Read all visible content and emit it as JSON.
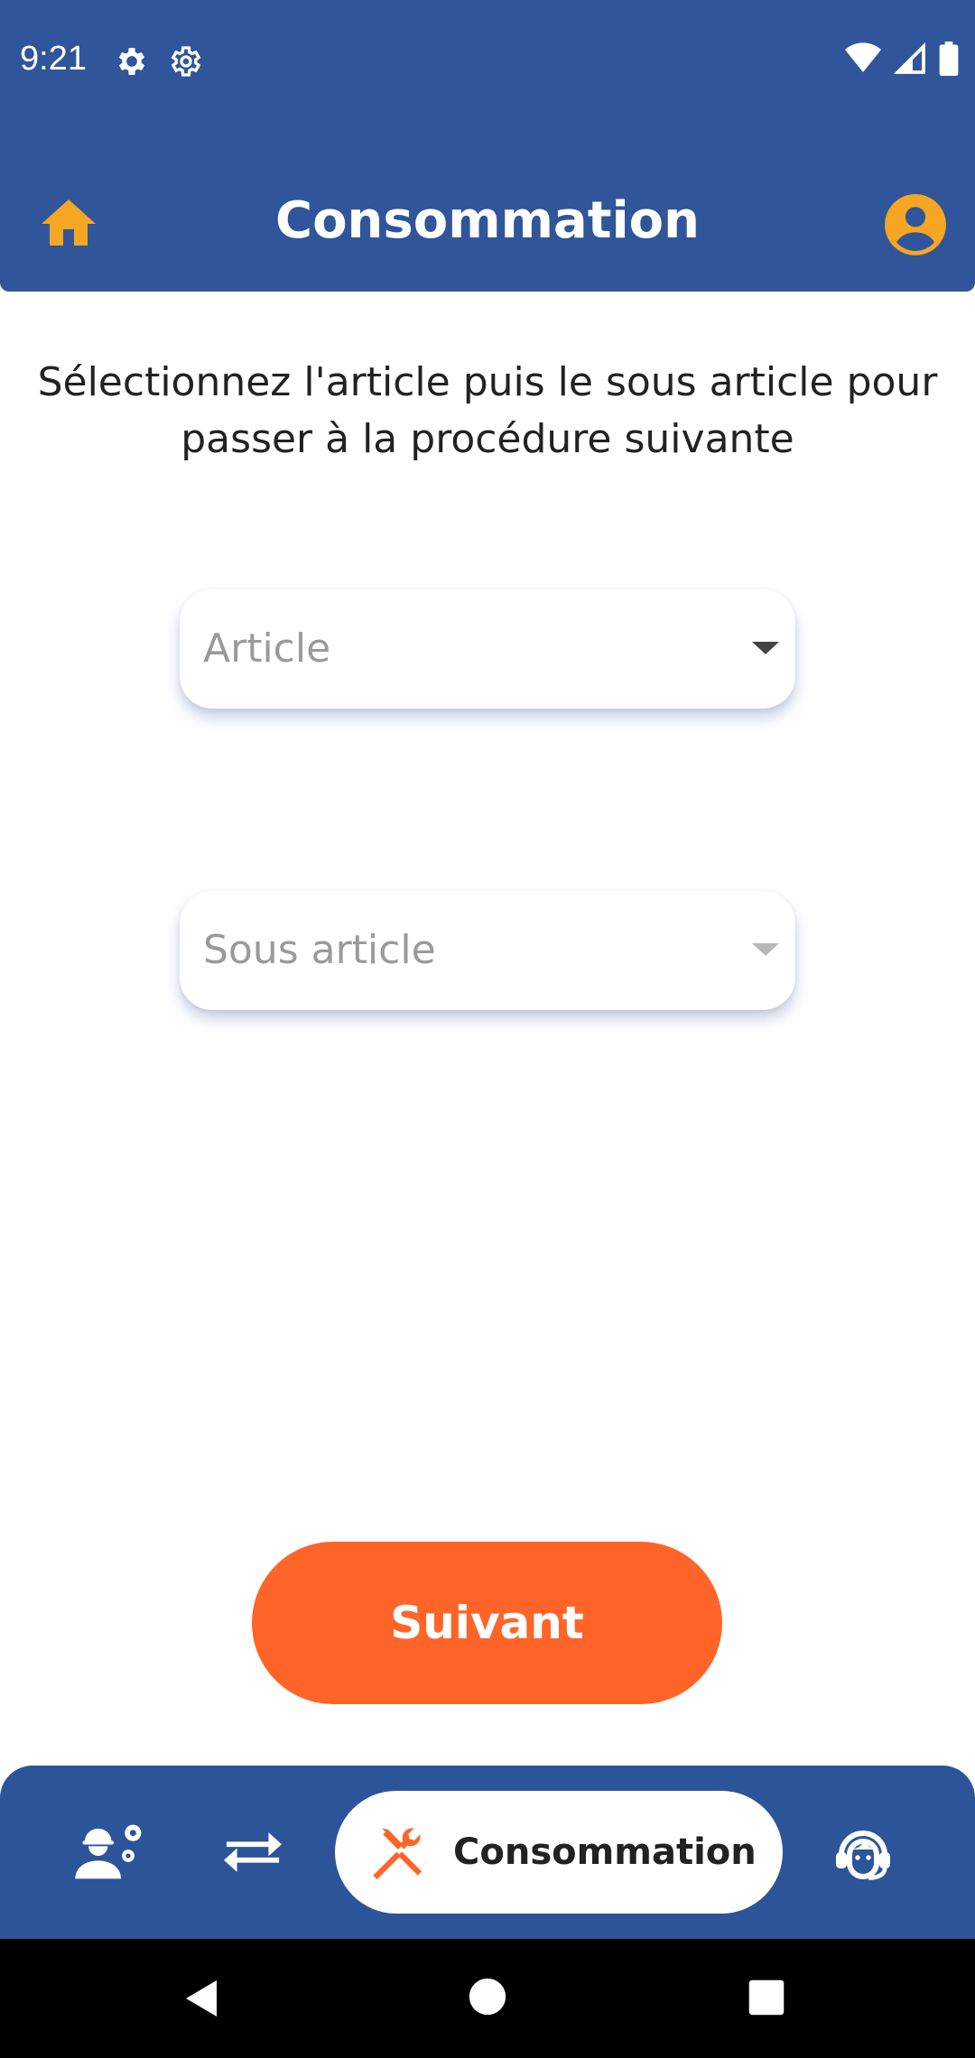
{
  "status_bar": {
    "time": "9:21",
    "icons": [
      "gear-icon",
      "gear-outline-icon",
      "wifi-icon",
      "signal-icon",
      "battery-icon"
    ]
  },
  "app_bar": {
    "title": "Consommation",
    "home_icon": "home-icon",
    "profile_icon": "account-circle-icon"
  },
  "main": {
    "instructions": "Sélectionnez l'article puis le sous article pour passer à la procédure suivante",
    "article_dropdown": {
      "placeholder": "Article",
      "enabled": true
    },
    "sous_article_dropdown": {
      "placeholder": "Sous article",
      "enabled": false
    },
    "next_button_label": "Suivant"
  },
  "bottom_nav": {
    "items": [
      {
        "icon": "worker-settings-icon",
        "active": false
      },
      {
        "icon": "swap-arrows-icon",
        "active": false
      },
      {
        "icon": "tools-icon",
        "label": "Consommation",
        "active": true
      },
      {
        "icon": "support-agent-icon",
        "active": false
      }
    ]
  },
  "colors": {
    "primary": "#30559A",
    "accent": "#FF6429",
    "home_icon": "#F5A623",
    "profile_icon": "#F5A623"
  }
}
